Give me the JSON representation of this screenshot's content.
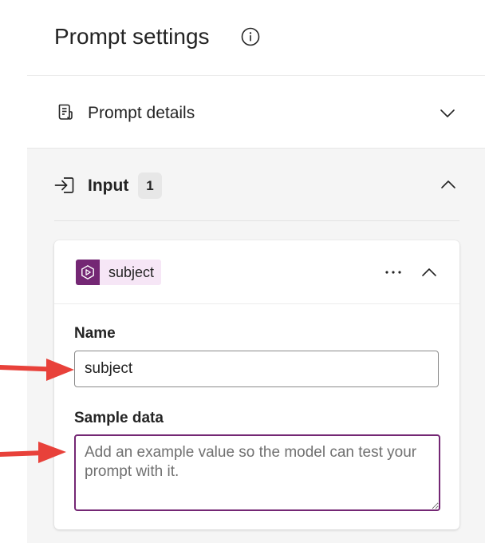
{
  "header": {
    "title": "Prompt settings",
    "info_icon": "info-icon"
  },
  "prompt_details": {
    "label": "Prompt details",
    "icon": "document-icon",
    "expanded": false
  },
  "input_section": {
    "label": "Input",
    "count": "1",
    "icon": "sign-in-arrow-icon",
    "expanded": true,
    "variable": {
      "chip_label": "subject",
      "chip_icon": "dataverse-icon",
      "name_label": "Name",
      "name_value": "subject",
      "sample_label": "Sample data",
      "sample_value": "",
      "sample_placeholder": "Add an example value so the model can test your prompt with it."
    }
  },
  "colors": {
    "accent": "#742774",
    "chip_bg": "#f6e6f6",
    "annotation_arrow": "#e8413a",
    "section_bg": "#f5f5f5"
  }
}
